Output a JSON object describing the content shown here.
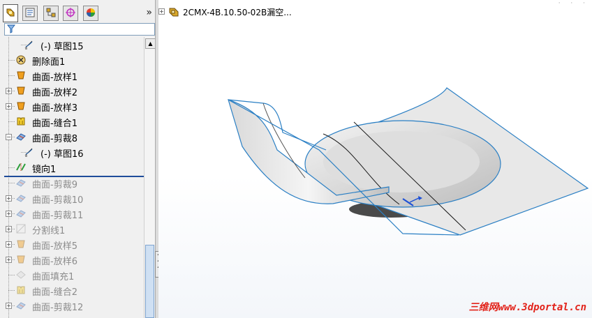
{
  "tabs": [
    {
      "name": "feature-manager",
      "icon": "feature-tree-icon"
    },
    {
      "name": "property-manager",
      "icon": "property-icon"
    },
    {
      "name": "configuration-manager",
      "icon": "configuration-icon"
    },
    {
      "name": "dimxpert-manager",
      "icon": "target-icon"
    },
    {
      "name": "display-manager",
      "icon": "color-wheel-icon"
    }
  ],
  "tabs_more": "»",
  "filter": {
    "value": ""
  },
  "tree": {
    "items": [
      {
        "label": "(-) 草图15",
        "indent": 2,
        "icon": "sketch-icon",
        "expandable": false,
        "dim": false
      },
      {
        "label": "删除面1",
        "indent": 1,
        "icon": "delete-face-icon",
        "expandable": false,
        "dim": false
      },
      {
        "label": "曲面-放样1",
        "indent": 1,
        "icon": "surface-loft-icon",
        "expandable": false,
        "dim": false
      },
      {
        "label": "曲面-放样2",
        "indent": 1,
        "icon": "surface-loft-icon",
        "expandable": true,
        "dim": false
      },
      {
        "label": "曲面-放样3",
        "indent": 1,
        "icon": "surface-loft-icon",
        "expandable": true,
        "dim": false
      },
      {
        "label": "曲面-缝合1",
        "indent": 1,
        "icon": "surface-knit-icon",
        "expandable": false,
        "dim": false
      },
      {
        "label": "曲面-剪裁8",
        "indent": 1,
        "icon": "surface-trim-icon",
        "expandable": true,
        "expanded": true,
        "dim": false
      },
      {
        "label": "(-) 草图16",
        "indent": 2,
        "icon": "sketch-icon",
        "expandable": false,
        "dim": false
      },
      {
        "label": "镜向1",
        "indent": 1,
        "icon": "mirror-icon",
        "expandable": false,
        "dim": false
      },
      {
        "label": "曲面-剪裁9",
        "indent": 1,
        "icon": "surface-trim-icon",
        "expandable": false,
        "dim": true
      },
      {
        "label": "曲面-剪裁10",
        "indent": 1,
        "icon": "surface-trim-icon",
        "expandable": true,
        "dim": true
      },
      {
        "label": "曲面-剪裁11",
        "indent": 1,
        "icon": "surface-trim-icon",
        "expandable": true,
        "dim": true
      },
      {
        "label": "分割线1",
        "indent": 1,
        "icon": "split-line-icon",
        "expandable": true,
        "dim": true
      },
      {
        "label": "曲面-放样5",
        "indent": 1,
        "icon": "surface-loft-icon",
        "expandable": true,
        "dim": true
      },
      {
        "label": "曲面-放样6",
        "indent": 1,
        "icon": "surface-loft-icon",
        "expandable": true,
        "dim": true
      },
      {
        "label": "曲面填充1",
        "indent": 1,
        "icon": "surface-fill-icon",
        "expandable": false,
        "dim": true
      },
      {
        "label": "曲面-缝合2",
        "indent": 1,
        "icon": "surface-knit-icon",
        "expandable": false,
        "dim": true
      },
      {
        "label": "曲面-剪裁12",
        "indent": 1,
        "icon": "surface-trim-icon",
        "expandable": true,
        "dim": true
      }
    ]
  },
  "viewport": {
    "document_title": "2CMX-4B.10.50-02B漏空...",
    "document_icon": "part-icon"
  },
  "watermark": {
    "prefix": "三维网",
    "url": "www.3dportal.cn"
  },
  "colors": {
    "model_edge": "#2a7fc4",
    "model_surface": "#e6e6e6",
    "rollback_bar": "#1e4c9a",
    "watermark": "#e2231a",
    "dim_text": "#8c8c8c"
  }
}
